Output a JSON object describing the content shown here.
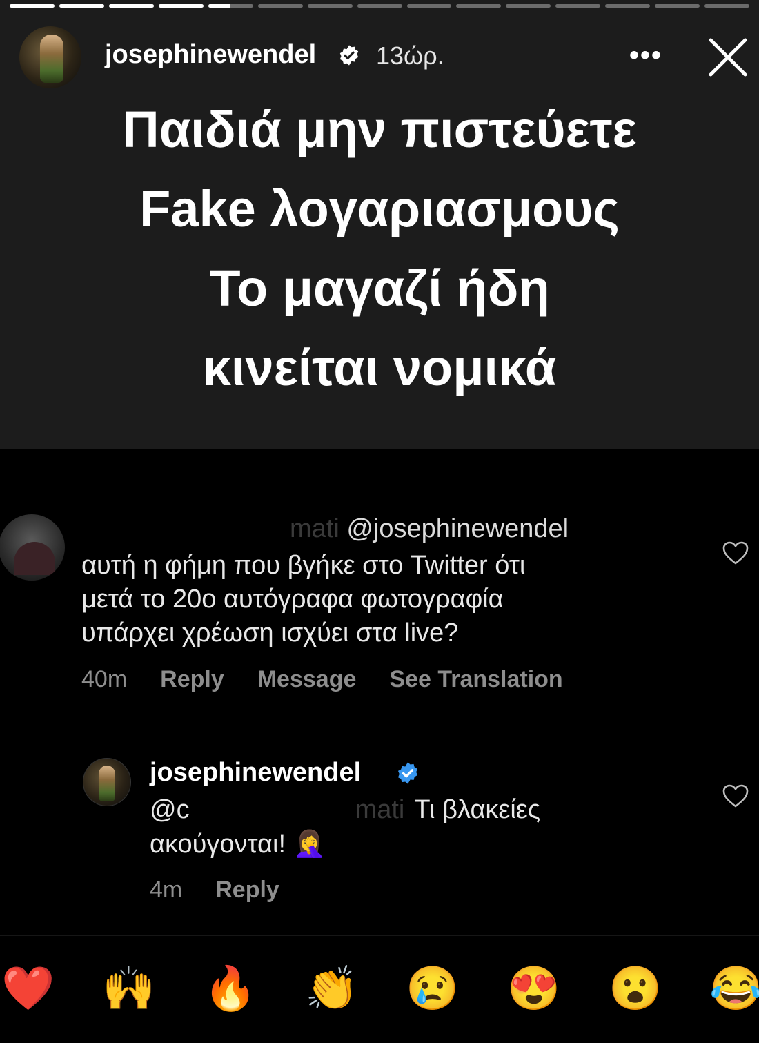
{
  "story": {
    "progress": [
      1,
      1,
      1,
      1,
      0.5,
      0,
      0,
      0,
      0,
      0,
      0,
      0,
      0,
      0,
      0
    ],
    "username": "josephinewendel",
    "time": "13ώρ.",
    "more_label": "•••",
    "text_lines": [
      "Παιδιά μην πιστεύετε",
      "Fake λογαριασμους",
      "Το μαγαζί ήδη",
      "κινείται νομικά"
    ]
  },
  "comments": [
    {
      "username_fragment": "mati",
      "mention": "@josephinewendel",
      "body_lines": [
        "αυτή η φήμη που βγήκε στο Twitter ότι",
        "μετά το 20ο αυτόγραφα φωτογραφία",
        "υπάρχει χρέωση ισχύει στα live?"
      ],
      "time": "40m",
      "actions": [
        "Reply",
        "Message",
        "See Translation"
      ]
    },
    {
      "username": "josephinewendel",
      "mention_prefix": "@c",
      "mention_fragment": "mati",
      "body_line1": "Τι βλακείες",
      "body_line2": "ακούγονται!",
      "body_emoji": "🤦‍♀️",
      "time": "4m",
      "actions": [
        "Reply"
      ]
    }
  ],
  "reactions": [
    "❤️",
    "🙌",
    "🔥",
    "👏",
    "😢",
    "😍",
    "😮",
    "😂"
  ],
  "colors": {
    "story_bg": "#1c1c1c",
    "page_bg": "#000000",
    "verified_blue": "#3897f0",
    "meta_gray": "#8e8e8e"
  }
}
